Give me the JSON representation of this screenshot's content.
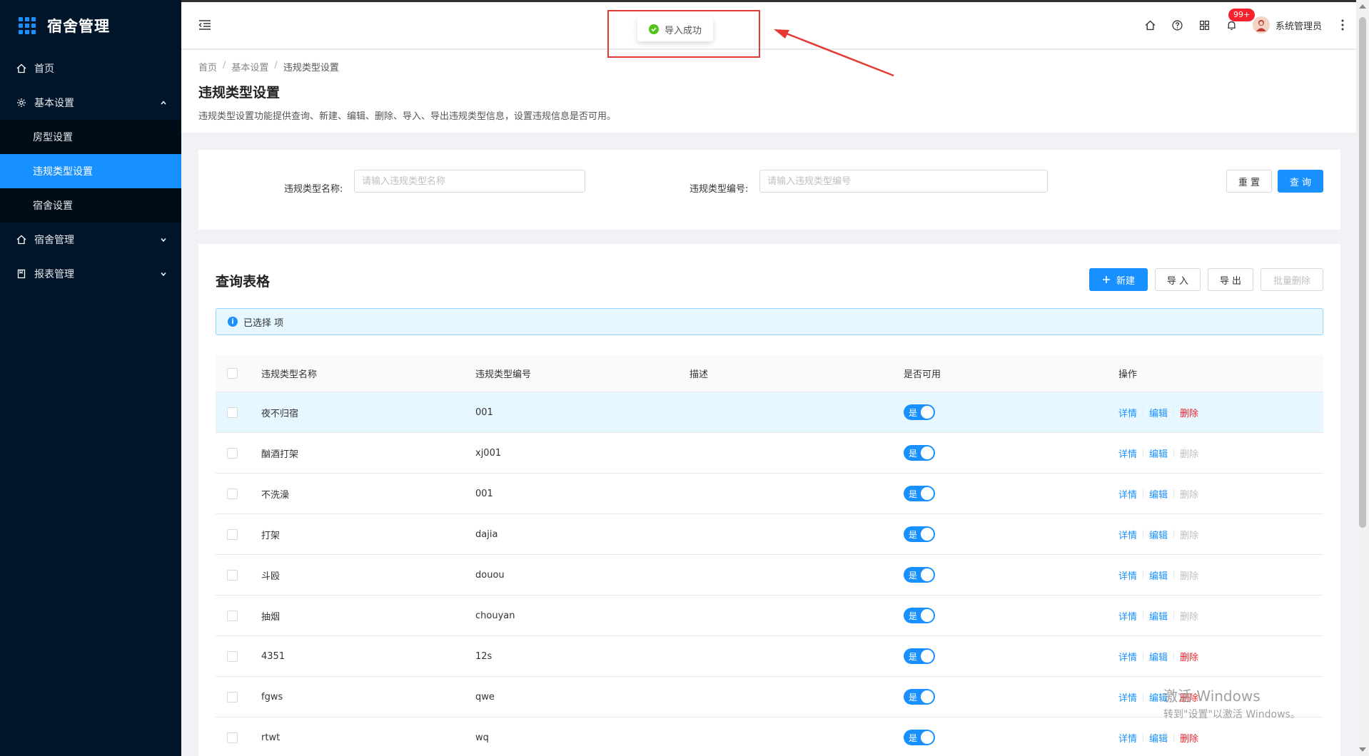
{
  "app": {
    "title": "宿舍管理"
  },
  "sidebar": {
    "items": [
      {
        "label": "首页",
        "icon": "home-icon"
      },
      {
        "label": "基本设置",
        "icon": "gear-icon",
        "expanded": true,
        "children": [
          {
            "label": "房型设置"
          },
          {
            "label": "违规类型设置",
            "active": true
          },
          {
            "label": "宿舍设置"
          }
        ]
      },
      {
        "label": "宿舍管理",
        "icon": "home-icon"
      },
      {
        "label": "报表管理",
        "icon": "report-icon"
      }
    ]
  },
  "header": {
    "notification_badge": "99+",
    "username": "系统管理员"
  },
  "toast": {
    "message": "导入成功"
  },
  "breadcrumb": [
    "首页",
    "基本设置",
    "违规类型设置"
  ],
  "page": {
    "title": "违规类型设置",
    "description": "违规类型设置功能提供查询、新建、编辑、删除、导入、导出违规类型信息，设置违规信息是否可用。"
  },
  "filter": {
    "name_label": "违规类型名称:",
    "name_placeholder": "请输入违规类型名称",
    "code_label": "违规类型编号:",
    "code_placeholder": "请输入违规类型编号",
    "reset_label": "重 置",
    "search_label": "查 询"
  },
  "table_card": {
    "title": "查询表格",
    "new_label": "新建",
    "import_label": "导 入",
    "export_label": "导 出",
    "batch_delete_label": "批量删除",
    "alert_text": "已选择 项"
  },
  "table": {
    "columns": [
      "违规类型名称",
      "违规类型编号",
      "描述",
      "是否可用",
      "操作"
    ],
    "rows": [
      {
        "name": "夜不归宿",
        "code": "001",
        "desc": "",
        "enabled": "是",
        "delete_enabled": true
      },
      {
        "name": "酗酒打架",
        "code": "xj001",
        "desc": "",
        "enabled": "是",
        "delete_enabled": false
      },
      {
        "name": "不洗澡",
        "code": "001",
        "desc": "",
        "enabled": "是",
        "delete_enabled": false
      },
      {
        "name": "打架",
        "code": "dajia",
        "desc": "",
        "enabled": "是",
        "delete_enabled": false
      },
      {
        "name": "斗殴",
        "code": "douou",
        "desc": "",
        "enabled": "是",
        "delete_enabled": false
      },
      {
        "name": "抽烟",
        "code": "chouyan",
        "desc": "",
        "enabled": "是",
        "delete_enabled": false
      },
      {
        "name": "4351",
        "code": "12s",
        "desc": "",
        "enabled": "是",
        "delete_enabled": true
      },
      {
        "name": "fgws",
        "code": "qwe",
        "desc": "",
        "enabled": "是",
        "delete_enabled": true
      },
      {
        "name": "rtwt",
        "code": "wq",
        "desc": "",
        "enabled": "是",
        "delete_enabled": true
      }
    ],
    "actions": {
      "detail": "详情",
      "edit": "编辑",
      "delete": "删除"
    }
  },
  "watermark": {
    "line1": "激活 Windows",
    "line2": "转到\"设置\"以激活 Windows。"
  },
  "colors": {
    "primary": "#1890ff",
    "sidebar_bg": "#001529",
    "danger": "#f5222d",
    "success": "#52c41a"
  }
}
